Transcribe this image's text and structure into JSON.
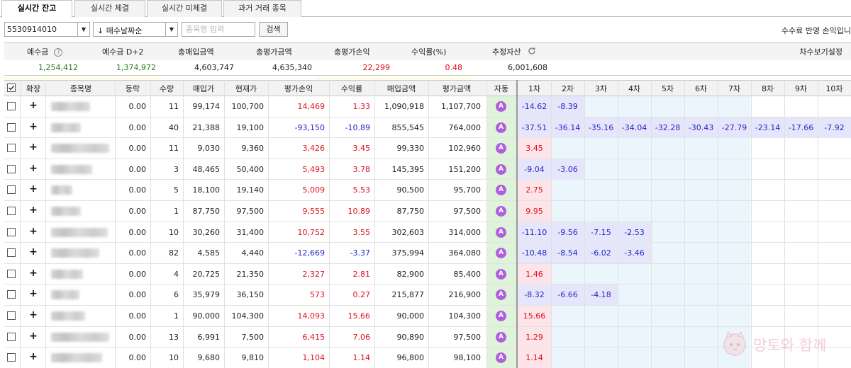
{
  "tabs": [
    "실시간 잔고",
    "실시간 체결",
    "실시간 미체결",
    "과거 거래 종목"
  ],
  "toolbar": {
    "account_number": "5530914010",
    "sort_option": "↓ 매수날짜순",
    "stock_input_placeholder": "종목명 입력",
    "search_label": "검색",
    "fee_label": "수수료 반영 손익입니"
  },
  "summary": {
    "headers": [
      "예수금",
      "예수금 D+2",
      "총매입금액",
      "총평가금액",
      "총평가손익",
      "수익률(%)",
      "추정자산"
    ],
    "values": [
      "1,254,412",
      "1,374,972",
      "4,603,747",
      "4,635,340",
      "22,299",
      "0.48",
      "6,001,608"
    ],
    "settings_label": "차수보기설정"
  },
  "grid": {
    "columns": [
      "확장",
      "종목명",
      "등락",
      "수량",
      "매입가",
      "현재가",
      "평가손익",
      "수익률",
      "매입금액",
      "평가금액",
      "자동",
      "1차",
      "2차",
      "3차",
      "4차",
      "5차",
      "6차",
      "7차",
      "8차",
      "9차",
      "10차"
    ],
    "auto_badge": "A",
    "rows": [
      {
        "change": "0.00",
        "qty": "11",
        "buy_price": "99,174",
        "cur_price": "100,700",
        "pnl": "14,469",
        "rate": "1.33",
        "buy_amt": "1,090,918",
        "eval_amt": "1,107,700",
        "tiers": [
          "-14.62",
          "-8.39"
        ]
      },
      {
        "change": "0.00",
        "qty": "40",
        "buy_price": "21,388",
        "cur_price": "19,100",
        "pnl": "-93,150",
        "rate": "-10.89",
        "buy_amt": "855,545",
        "eval_amt": "764,000",
        "tiers": [
          "-37.51",
          "-36.14",
          "-35.16",
          "-34.04",
          "-32.28",
          "-30.43",
          "-27.79",
          "-23.14",
          "-17.66",
          "-7.92"
        ]
      },
      {
        "change": "0.00",
        "qty": "11",
        "buy_price": "9,030",
        "cur_price": "9,360",
        "pnl": "3,426",
        "rate": "3.45",
        "buy_amt": "99,330",
        "eval_amt": "102,960",
        "tiers": [
          "3.45"
        ]
      },
      {
        "change": "0.00",
        "qty": "3",
        "buy_price": "48,465",
        "cur_price": "50,400",
        "pnl": "5,493",
        "rate": "3.78",
        "buy_amt": "145,395",
        "eval_amt": "151,200",
        "tiers": [
          "-9.04",
          "-3.06"
        ]
      },
      {
        "change": "0.00",
        "qty": "5",
        "buy_price": "18,100",
        "cur_price": "19,140",
        "pnl": "5,009",
        "rate": "5.53",
        "buy_amt": "90,500",
        "eval_amt": "95,700",
        "tiers": [
          "2.75"
        ]
      },
      {
        "change": "0.00",
        "qty": "1",
        "buy_price": "87,750",
        "cur_price": "97,500",
        "pnl": "9,555",
        "rate": "10.89",
        "buy_amt": "87,750",
        "eval_amt": "97,500",
        "tiers": [
          "9.95"
        ]
      },
      {
        "change": "0.00",
        "qty": "10",
        "buy_price": "30,260",
        "cur_price": "31,400",
        "pnl": "10,752",
        "rate": "3.55",
        "buy_amt": "302,603",
        "eval_amt": "314,000",
        "tiers": [
          "-11.10",
          "-9.56",
          "-7.15",
          "-2.53"
        ]
      },
      {
        "change": "0.00",
        "qty": "82",
        "buy_price": "4,585",
        "cur_price": "4,440",
        "pnl": "-12,669",
        "rate": "-3.37",
        "buy_amt": "375,994",
        "eval_amt": "364,080",
        "tiers": [
          "-10.48",
          "-8.54",
          "-6.02",
          "-3.46"
        ]
      },
      {
        "change": "0.00",
        "qty": "4",
        "buy_price": "20,725",
        "cur_price": "21,350",
        "pnl": "2,327",
        "rate": "2.81",
        "buy_amt": "82,900",
        "eval_amt": "85,400",
        "tiers": [
          "1.46"
        ]
      },
      {
        "change": "0.00",
        "qty": "6",
        "buy_price": "35,979",
        "cur_price": "36,150",
        "pnl": "573",
        "rate": "0.27",
        "buy_amt": "215,877",
        "eval_amt": "216,900",
        "tiers": [
          "-8.32",
          "-6.66",
          "-4.18"
        ]
      },
      {
        "change": "0.00",
        "qty": "1",
        "buy_price": "90,000",
        "cur_price": "104,300",
        "pnl": "14,093",
        "rate": "15.66",
        "buy_amt": "90,000",
        "eval_amt": "104,300",
        "tiers": [
          "15.66"
        ]
      },
      {
        "change": "0.00",
        "qty": "13",
        "buy_price": "6,991",
        "cur_price": "7,500",
        "pnl": "6,415",
        "rate": "7.06",
        "buy_amt": "90,890",
        "eval_amt": "97,500",
        "tiers": [
          "1.29"
        ]
      },
      {
        "change": "0.00",
        "qty": "10",
        "buy_price": "9,680",
        "cur_price": "9,810",
        "pnl": "1,104",
        "rate": "1.14",
        "buy_amt": "96,800",
        "eval_amt": "98,100",
        "tiers": [
          "1.14"
        ]
      }
    ]
  },
  "colors": {
    "positive": "#e0101b",
    "negative": "#2424c8",
    "deposit_green": "#2a7d1c",
    "auto_badge": "#b05ee0",
    "auto_column_bg": "#def3d9",
    "tier_bg": "#eaf6fb"
  },
  "watermark": "망토와 함께"
}
